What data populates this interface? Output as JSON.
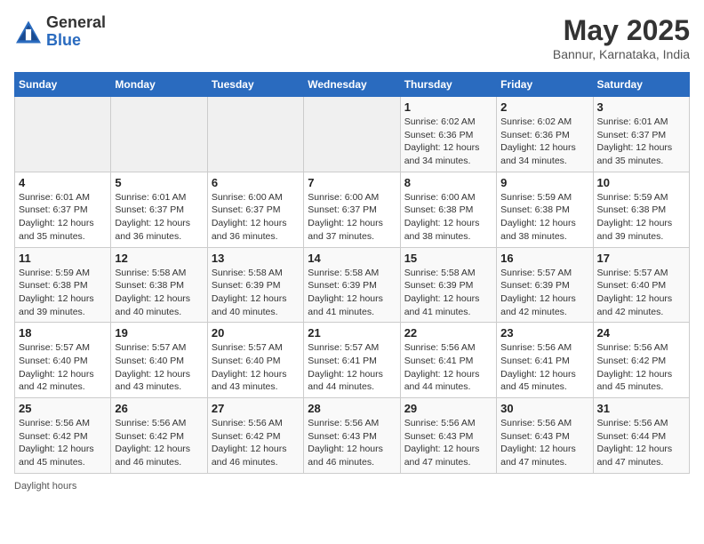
{
  "header": {
    "logo_general": "General",
    "logo_blue": "Blue",
    "month_title": "May 2025",
    "subtitle": "Bannur, Karnataka, India"
  },
  "footer": {
    "daylight_label": "Daylight hours"
  },
  "weekdays": [
    "Sunday",
    "Monday",
    "Tuesday",
    "Wednesday",
    "Thursday",
    "Friday",
    "Saturday"
  ],
  "weeks": [
    [
      {
        "day": "",
        "info": ""
      },
      {
        "day": "",
        "info": ""
      },
      {
        "day": "",
        "info": ""
      },
      {
        "day": "",
        "info": ""
      },
      {
        "day": "1",
        "info": "Sunrise: 6:02 AM\nSunset: 6:36 PM\nDaylight: 12 hours\nand 34 minutes."
      },
      {
        "day": "2",
        "info": "Sunrise: 6:02 AM\nSunset: 6:36 PM\nDaylight: 12 hours\nand 34 minutes."
      },
      {
        "day": "3",
        "info": "Sunrise: 6:01 AM\nSunset: 6:37 PM\nDaylight: 12 hours\nand 35 minutes."
      }
    ],
    [
      {
        "day": "4",
        "info": "Sunrise: 6:01 AM\nSunset: 6:37 PM\nDaylight: 12 hours\nand 35 minutes."
      },
      {
        "day": "5",
        "info": "Sunrise: 6:01 AM\nSunset: 6:37 PM\nDaylight: 12 hours\nand 36 minutes."
      },
      {
        "day": "6",
        "info": "Sunrise: 6:00 AM\nSunset: 6:37 PM\nDaylight: 12 hours\nand 36 minutes."
      },
      {
        "day": "7",
        "info": "Sunrise: 6:00 AM\nSunset: 6:37 PM\nDaylight: 12 hours\nand 37 minutes."
      },
      {
        "day": "8",
        "info": "Sunrise: 6:00 AM\nSunset: 6:38 PM\nDaylight: 12 hours\nand 38 minutes."
      },
      {
        "day": "9",
        "info": "Sunrise: 5:59 AM\nSunset: 6:38 PM\nDaylight: 12 hours\nand 38 minutes."
      },
      {
        "day": "10",
        "info": "Sunrise: 5:59 AM\nSunset: 6:38 PM\nDaylight: 12 hours\nand 39 minutes."
      }
    ],
    [
      {
        "day": "11",
        "info": "Sunrise: 5:59 AM\nSunset: 6:38 PM\nDaylight: 12 hours\nand 39 minutes."
      },
      {
        "day": "12",
        "info": "Sunrise: 5:58 AM\nSunset: 6:38 PM\nDaylight: 12 hours\nand 40 minutes."
      },
      {
        "day": "13",
        "info": "Sunrise: 5:58 AM\nSunset: 6:39 PM\nDaylight: 12 hours\nand 40 minutes."
      },
      {
        "day": "14",
        "info": "Sunrise: 5:58 AM\nSunset: 6:39 PM\nDaylight: 12 hours\nand 41 minutes."
      },
      {
        "day": "15",
        "info": "Sunrise: 5:58 AM\nSunset: 6:39 PM\nDaylight: 12 hours\nand 41 minutes."
      },
      {
        "day": "16",
        "info": "Sunrise: 5:57 AM\nSunset: 6:39 PM\nDaylight: 12 hours\nand 42 minutes."
      },
      {
        "day": "17",
        "info": "Sunrise: 5:57 AM\nSunset: 6:40 PM\nDaylight: 12 hours\nand 42 minutes."
      }
    ],
    [
      {
        "day": "18",
        "info": "Sunrise: 5:57 AM\nSunset: 6:40 PM\nDaylight: 12 hours\nand 42 minutes."
      },
      {
        "day": "19",
        "info": "Sunrise: 5:57 AM\nSunset: 6:40 PM\nDaylight: 12 hours\nand 43 minutes."
      },
      {
        "day": "20",
        "info": "Sunrise: 5:57 AM\nSunset: 6:40 PM\nDaylight: 12 hours\nand 43 minutes."
      },
      {
        "day": "21",
        "info": "Sunrise: 5:57 AM\nSunset: 6:41 PM\nDaylight: 12 hours\nand 44 minutes."
      },
      {
        "day": "22",
        "info": "Sunrise: 5:56 AM\nSunset: 6:41 PM\nDaylight: 12 hours\nand 44 minutes."
      },
      {
        "day": "23",
        "info": "Sunrise: 5:56 AM\nSunset: 6:41 PM\nDaylight: 12 hours\nand 45 minutes."
      },
      {
        "day": "24",
        "info": "Sunrise: 5:56 AM\nSunset: 6:42 PM\nDaylight: 12 hours\nand 45 minutes."
      }
    ],
    [
      {
        "day": "25",
        "info": "Sunrise: 5:56 AM\nSunset: 6:42 PM\nDaylight: 12 hours\nand 45 minutes."
      },
      {
        "day": "26",
        "info": "Sunrise: 5:56 AM\nSunset: 6:42 PM\nDaylight: 12 hours\nand 46 minutes."
      },
      {
        "day": "27",
        "info": "Sunrise: 5:56 AM\nSunset: 6:42 PM\nDaylight: 12 hours\nand 46 minutes."
      },
      {
        "day": "28",
        "info": "Sunrise: 5:56 AM\nSunset: 6:43 PM\nDaylight: 12 hours\nand 46 minutes."
      },
      {
        "day": "29",
        "info": "Sunrise: 5:56 AM\nSunset: 6:43 PM\nDaylight: 12 hours\nand 47 minutes."
      },
      {
        "day": "30",
        "info": "Sunrise: 5:56 AM\nSunset: 6:43 PM\nDaylight: 12 hours\nand 47 minutes."
      },
      {
        "day": "31",
        "info": "Sunrise: 5:56 AM\nSunset: 6:44 PM\nDaylight: 12 hours\nand 47 minutes."
      }
    ]
  ]
}
